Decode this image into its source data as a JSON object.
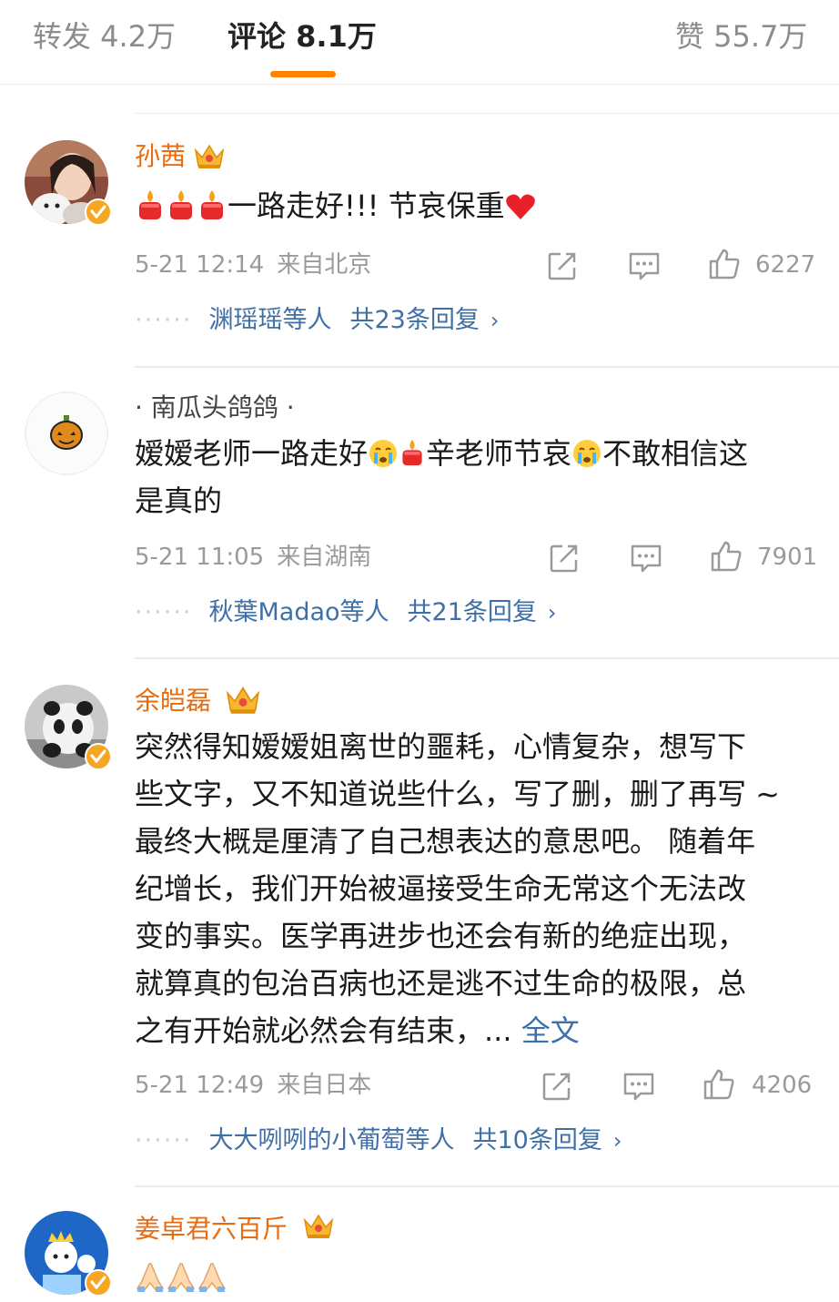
{
  "tabs": [
    {
      "label": "转发 4.2万",
      "active": false
    },
    {
      "label": "评论 8.1万",
      "active": true
    },
    {
      "label": "赞 55.7万",
      "active": false
    }
  ],
  "colors": {
    "accent": "#ff8200",
    "vip_name": "#e86b0f",
    "link": "#3f6fa6",
    "muted": "#9a9a9a"
  },
  "comments": [
    {
      "username": "孙茜",
      "verified": true,
      "crown": true,
      "content": "一路走好!!! 节哀保重",
      "emoji_prefix": [
        "candle-emoji",
        "candle-emoji",
        "candle-emoji"
      ],
      "emoji_suffix": "heart-emoji",
      "date": "5-21 12:14",
      "location": "来自北京",
      "likes": "6227",
      "reply_users": "渊瑶瑶等人",
      "reply_total": "共23条回复",
      "reply_chevron": "›"
    },
    {
      "username": "· 南瓜头鸽鸽 ·",
      "verified": false,
      "crown": false,
      "content_part1": "嫒嫒老师一路走好",
      "content_part2": "辛老师节哀",
      "content_part3": "不敢相信这",
      "content_part4": "是真的",
      "date": "5-21 11:05",
      "location": "来自湖南",
      "likes": "7901",
      "reply_users": "秋葉Madao等人",
      "reply_total": "共21条回复",
      "reply_chevron": "›"
    },
    {
      "username": "余皑磊",
      "verified": true,
      "crown": true,
      "lines": [
        "突然得知嫒嫒姐离世的噩耗，心情复杂，想写下",
        "些文字，又不知道说些什么，写了删，删了再写 ~",
        "最终大概是厘清了自己想表达的意思吧。 随着年",
        "纪增长，我们开始被逼接受生命无常这个无法改",
        "变的事实。医学再进步也还会有新的绝症出现，",
        "就算真的包治百病也还是逃不过生命的极限，总"
      ],
      "last_line": "之有开始就必然会有结束，... ",
      "more_label": "全文",
      "date": "5-21 12:49",
      "location": "来自日本",
      "likes": "4206",
      "reply_users": "大大咧咧的小葡萄等人",
      "reply_total": "共10条回复",
      "reply_chevron": "›"
    },
    {
      "username": "姜卓君六百斤",
      "verified": true,
      "crown": true,
      "emojis": [
        "pray-emoji",
        "pray-emoji",
        "pray-emoji"
      ]
    }
  ],
  "reply_dots": "······"
}
